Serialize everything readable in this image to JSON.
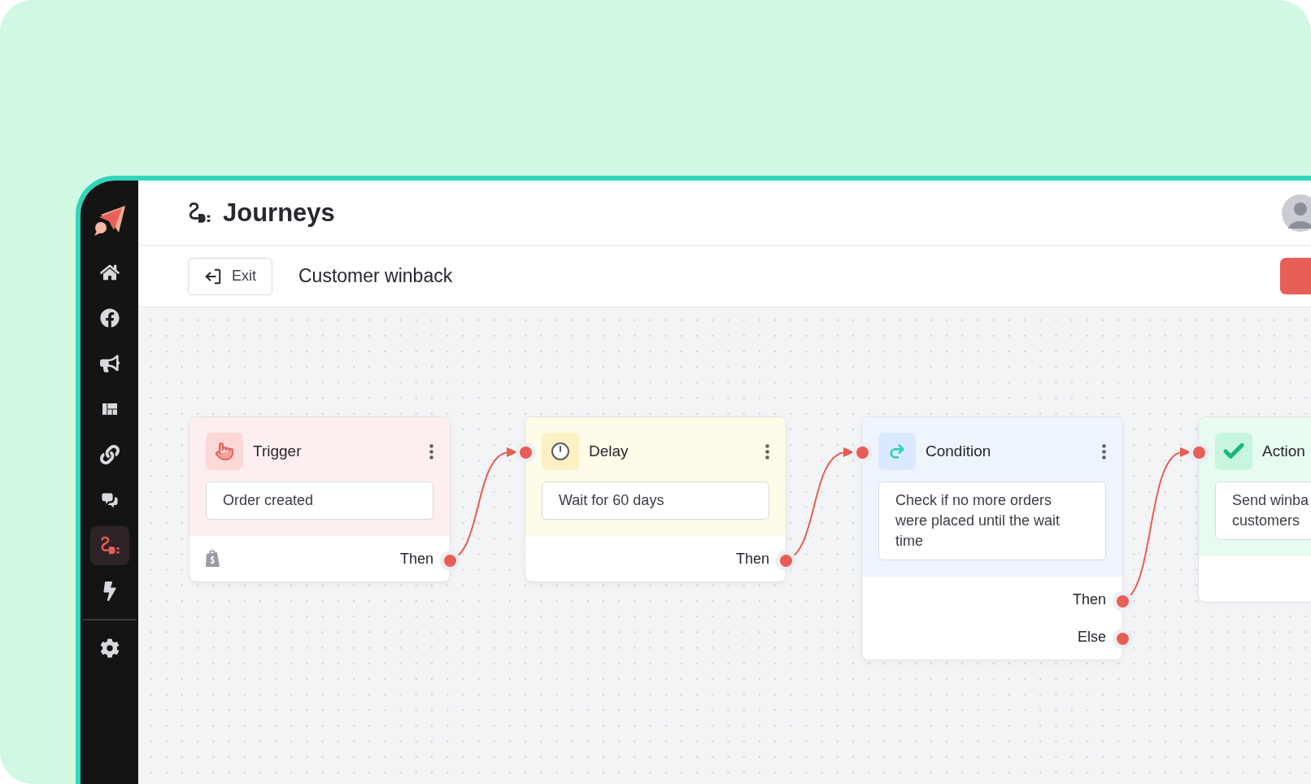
{
  "header": {
    "title": "Journeys"
  },
  "sidebar": {
    "items": [
      {
        "selected": false
      },
      {
        "selected": false
      },
      {
        "selected": false
      },
      {
        "selected": false
      },
      {
        "selected": false
      },
      {
        "selected": false
      },
      {
        "selected": true
      },
      {
        "selected": false
      },
      {
        "selected": false
      }
    ]
  },
  "toolbar": {
    "exit_label": "Exit",
    "journey_name": "Customer winback"
  },
  "nodes": [
    {
      "kind": "trigger",
      "title": "Trigger",
      "body": "Order created",
      "outputs": [
        {
          "label": "Then"
        }
      ]
    },
    {
      "kind": "delay",
      "title": "Delay",
      "body": "Wait for 60 days",
      "outputs": [
        {
          "label": "Then"
        }
      ]
    },
    {
      "kind": "condition",
      "title": "Condition",
      "body": "Check if no more orders were placed until the wait time",
      "outputs": [
        {
          "label": "Then"
        },
        {
          "label": "Else"
        }
      ]
    },
    {
      "kind": "action",
      "title": "Action",
      "body": "Send winba\ncustomers"
    }
  ]
}
